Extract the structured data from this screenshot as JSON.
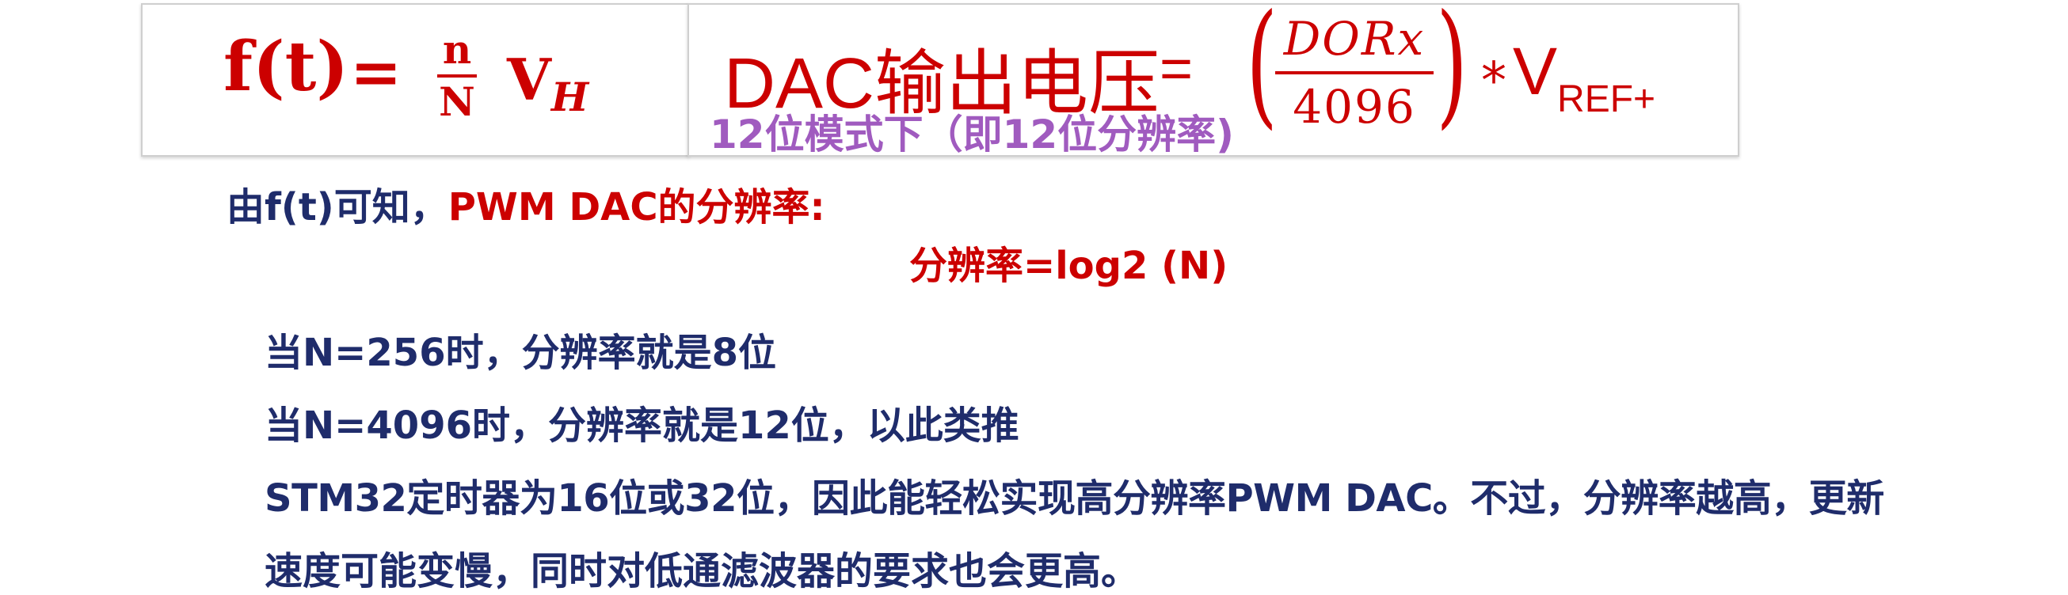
{
  "formula_left": {
    "lhs": "f(t)",
    "equals": "=",
    "numerator": "n",
    "denominator": "N",
    "v": "V",
    "v_sub": "H"
  },
  "formula_right": {
    "label": "DAC输出电压",
    "equals": "=",
    "paren_open": "(",
    "paren_close": ")",
    "numerator": "DORx",
    "denominator": "4096",
    "times": "*",
    "v": "V",
    "v_sub": "REF+",
    "note": "12位模式下（即12位分辨率)"
  },
  "body": {
    "intro_prefix": "由f(t)可知，",
    "intro_highlight": "PWM DAC的分辨率:",
    "resolution_formula": "分辨率=log2 (N)",
    "n256": "当N=256时，分辨率就是8位",
    "n4096": "当N=4096时，分辨率就是12位，以此类推",
    "stm_line1": "STM32定时器为16位或32位，因此能轻松实现高分辨率PWM DAC。不过，分辨率越高，更新",
    "stm_line2": "速度可能变慢，同时对低通滤波器的要求也会更高。"
  },
  "colors": {
    "red": "#cc0000",
    "navy": "#1f2c6b",
    "purple": "#a05bbf"
  }
}
